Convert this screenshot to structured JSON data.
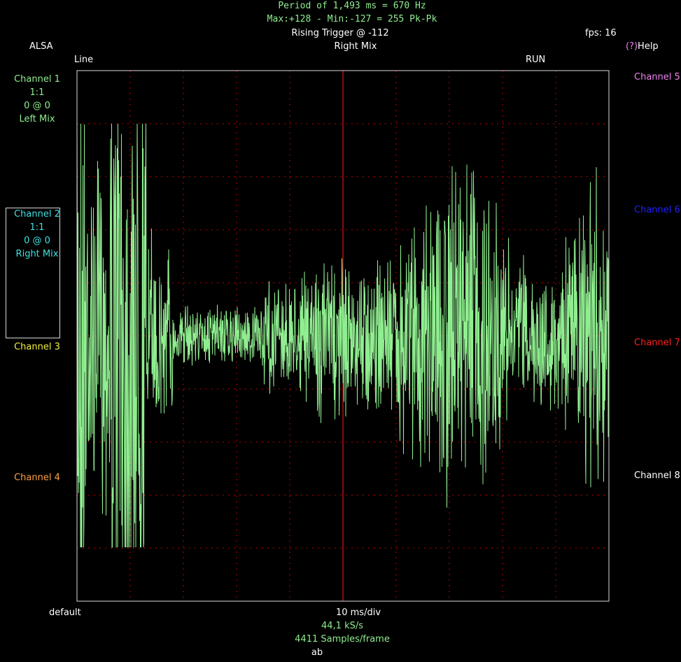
{
  "header": {
    "period_line": "Period of 1,493 ms =   670 Hz",
    "maxmin_line": "Max:+128 - Min:-127 = 255 Pk-Pk",
    "trigger": "Rising Trigger @ -112",
    "fps": "fps: 16",
    "source": "ALSA",
    "mix_mode": "Right Mix",
    "help_paren": "(?)",
    "help_label": "Help",
    "input": "Line",
    "run_state": "RUN"
  },
  "left_channels": [
    {
      "name": "Channel 1",
      "scale": "1:1",
      "pos": "0 @ 0",
      "source": "Left Mix",
      "color": "#90ee90"
    },
    {
      "name": "Channel 2",
      "scale": "1:1",
      "pos": "0 @ 0",
      "source": "Right Mix",
      "color": "#40e0e0"
    },
    {
      "name": "Channel 3",
      "color": "#f0f040"
    },
    {
      "name": "Channel 4",
      "color": "#ffa040"
    }
  ],
  "right_channels": [
    {
      "name": "Channel 5",
      "color": "#ee82ee"
    },
    {
      "name": "Channel 6",
      "color": "#2020ff"
    },
    {
      "name": "Channel 7",
      "color": "#ff2020"
    },
    {
      "name": "Channel 8",
      "color": "#ffffff"
    }
  ],
  "footer": {
    "preset": "default",
    "timebase": "10 ms/div",
    "sample_rate": "44,1 kS/s",
    "samples": "4411 Samples/frame",
    "mode": "ab"
  },
  "colors": {
    "trace": "#90ee90",
    "grid": "#c00000",
    "trigger_line": "#ff1a1a",
    "border": "#d8d8d8",
    "header_text": "#90ee90"
  }
}
